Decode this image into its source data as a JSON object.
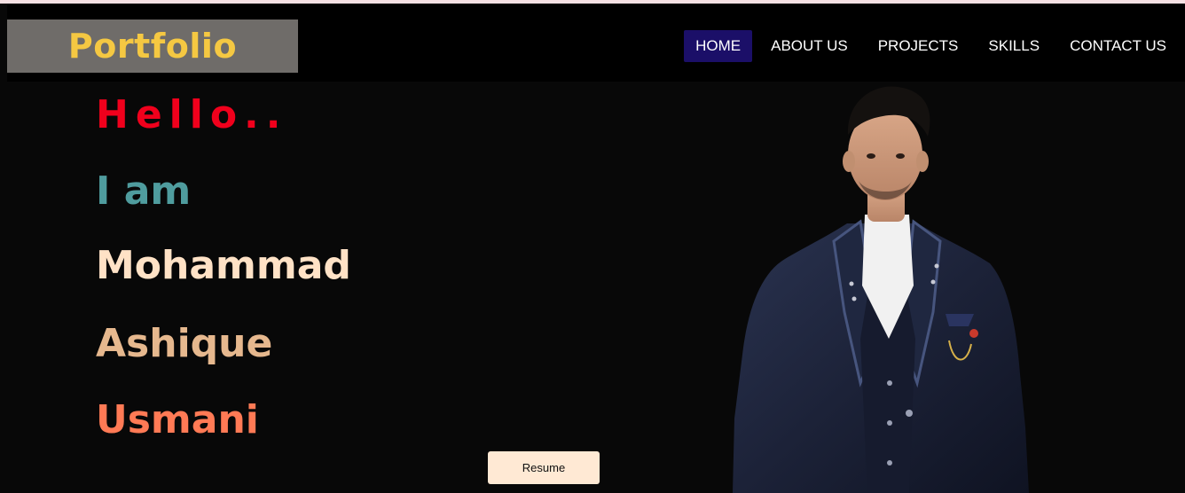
{
  "navbar": {
    "brand": "Portfolio",
    "links": [
      {
        "label": "HOME",
        "active": true
      },
      {
        "label": "ABOUT US",
        "active": false
      },
      {
        "label": "PROJECTS",
        "active": false
      },
      {
        "label": "SKILLS",
        "active": false
      },
      {
        "label": "CONTACT US",
        "active": false
      }
    ]
  },
  "hero": {
    "greeting": "Hello..",
    "intro": "I am",
    "first_name": "Mohammad",
    "middle_name": "Ashique",
    "last_name": "Usmani",
    "resume_label": "Resume"
  },
  "colors": {
    "brand_text": "#f5c842",
    "brand_bg": "#6f6c69",
    "active_nav": "#1b0f68",
    "greeting": "#f0001c",
    "intro": "#4f9c9e",
    "first_name": "#ffe2c6",
    "middle_name": "#e6b88e",
    "last_name": "#ff7a55",
    "background": "#080808"
  },
  "icons": {
    "portrait": "person-portrait-image"
  }
}
